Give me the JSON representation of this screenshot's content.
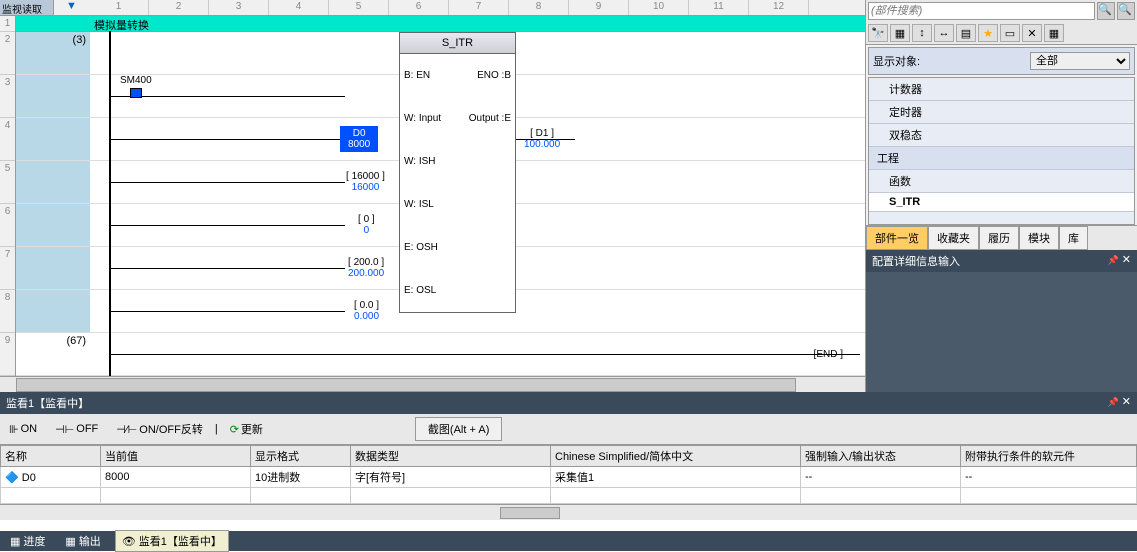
{
  "header": {
    "mode": "监视读取",
    "arrow": "▼",
    "cols": [
      "1",
      "2",
      "3",
      "4",
      "5",
      "6",
      "7",
      "8",
      "9",
      "10",
      "11",
      "12"
    ]
  },
  "ladder": {
    "row_nums": [
      "1",
      "2",
      "3",
      "4",
      "5",
      "6",
      "7",
      "8",
      "9"
    ],
    "title": "模拟量转换",
    "step3": "(3)",
    "step67": "(67)",
    "contact_sm400": "SM400",
    "fb_name": "S_ITR",
    "fb_ports": {
      "en": "B: EN",
      "eno": "ENO :B",
      "input": "W: Input",
      "output": "Output :E",
      "ish": "W: ISH",
      "isl": "W: ISL",
      "osh": "E: OSH",
      "osl": "E: OSL"
    },
    "params": {
      "d0_label": "D0",
      "d0_value": "8000",
      "d1_label": "D1",
      "d1_value": "100.000",
      "ish_label": "16000",
      "ish_value": "16000",
      "isl_label": "0",
      "isl_value": "0",
      "osh_label": "200.0",
      "osh_value": "200.000",
      "osl_label": "0.0",
      "osl_value": "0.000"
    },
    "end": "END"
  },
  "right": {
    "search_placeholder": "(部件搜索)",
    "display_target_label": "显示对象:",
    "display_target_value": "全部",
    "tree": {
      "counter": "计数器",
      "timer": "定时器",
      "bistable": "双稳态",
      "project": "工程",
      "function": "函数",
      "sitr": "S_ITR"
    },
    "tabs": {
      "parts": "部件一览",
      "favorites": "收藏夹",
      "history": "履历",
      "module": "模块",
      "library": "库"
    },
    "detail_title": "配置详细信息输入"
  },
  "watch": {
    "title": "监看1【监看中】",
    "on_btn": "ON",
    "off_btn": "OFF",
    "onoff_btn": "ON/OFF反转",
    "update_btn": "更新",
    "screenshot_btn": "截图(Alt + A)",
    "columns": {
      "name": "名称",
      "current": "当前值",
      "format": "显示格式",
      "datatype": "数据类型",
      "lang": "Chinese Simplified/简体中文",
      "force": "强制输入/输出状态",
      "device": "附带执行条件的软元件"
    },
    "row": {
      "name": "D0",
      "current": "8000",
      "format": "10进制数",
      "datatype": "字[有符号]",
      "lang": "采集值1",
      "force": "--",
      "device": "--"
    }
  },
  "status": {
    "progress": "进度",
    "output": "输出",
    "watch": "监看1【监看中】"
  }
}
